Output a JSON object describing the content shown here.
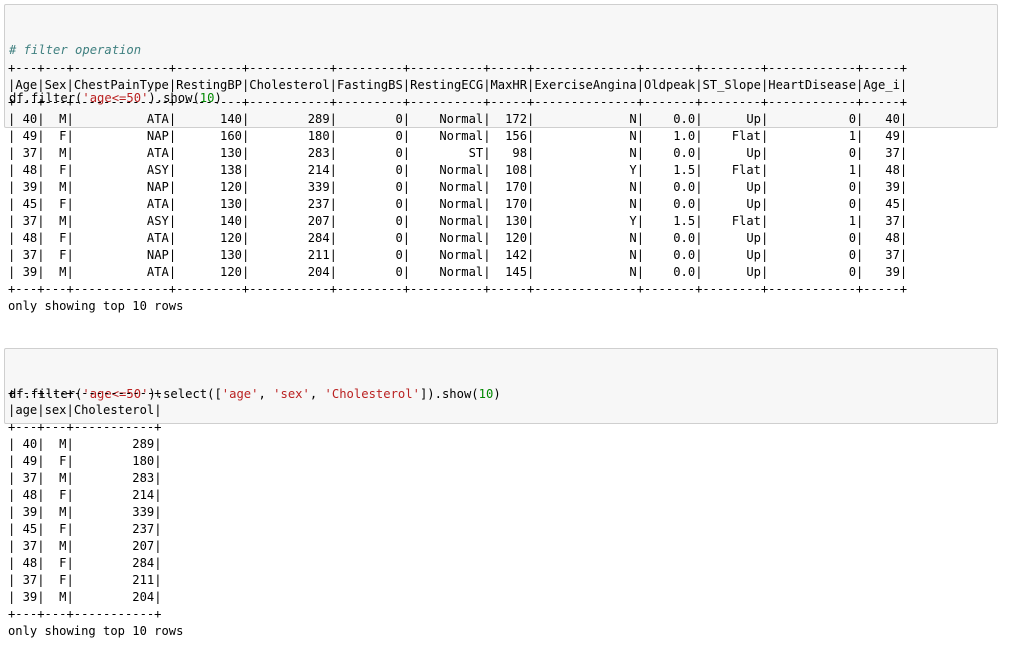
{
  "cells": [
    {
      "code_comment": "# filter operation",
      "code_line": {
        "prefix": "df.filter(",
        "arg": "'age<=50'",
        "mid": ").show(",
        "num": "10",
        "suffix": ")"
      },
      "table": {
        "columns": [
          "Age",
          "Sex",
          "ChestPainType",
          "RestingBP",
          "Cholesterol",
          "FastingBS",
          "RestingECG",
          "MaxHR",
          "ExerciseAngina",
          "Oldpeak",
          "ST_Slope",
          "HeartDisease",
          "Age_i"
        ],
        "rows": [
          [
            "40",
            "M",
            "ATA",
            "140",
            "289",
            "0",
            "Normal",
            "172",
            "N",
            "0.0",
            "Up",
            "0",
            "40"
          ],
          [
            "49",
            "F",
            "NAP",
            "160",
            "180",
            "0",
            "Normal",
            "156",
            "N",
            "1.0",
            "Flat",
            "1",
            "49"
          ],
          [
            "37",
            "M",
            "ATA",
            "130",
            "283",
            "0",
            "ST",
            "98",
            "N",
            "0.0",
            "Up",
            "0",
            "37"
          ],
          [
            "48",
            "F",
            "ASY",
            "138",
            "214",
            "0",
            "Normal",
            "108",
            "Y",
            "1.5",
            "Flat",
            "1",
            "48"
          ],
          [
            "39",
            "M",
            "NAP",
            "120",
            "339",
            "0",
            "Normal",
            "170",
            "N",
            "0.0",
            "Up",
            "0",
            "39"
          ],
          [
            "45",
            "F",
            "ATA",
            "130",
            "237",
            "0",
            "Normal",
            "170",
            "N",
            "0.0",
            "Up",
            "0",
            "45"
          ],
          [
            "37",
            "M",
            "ASY",
            "140",
            "207",
            "0",
            "Normal",
            "130",
            "Y",
            "1.5",
            "Flat",
            "1",
            "37"
          ],
          [
            "48",
            "F",
            "ATA",
            "120",
            "284",
            "0",
            "Normal",
            "120",
            "N",
            "0.0",
            "Up",
            "0",
            "48"
          ],
          [
            "37",
            "F",
            "NAP",
            "130",
            "211",
            "0",
            "Normal",
            "142",
            "N",
            "0.0",
            "Up",
            "0",
            "37"
          ],
          [
            "39",
            "M",
            "ATA",
            "120",
            "204",
            "0",
            "Normal",
            "145",
            "N",
            "0.0",
            "Up",
            "0",
            "39"
          ]
        ],
        "footer": "only showing top 10 rows"
      }
    },
    {
      "code_line": {
        "prefix": "df.filter(",
        "arg": "'age<=50'",
        "mid": ").select([",
        "list_items": [
          "'age'",
          "'sex'",
          "'Cholesterol'"
        ],
        "mid2": "]).show(",
        "num": "10",
        "suffix": ")"
      },
      "table": {
        "columns": [
          "age",
          "sex",
          "Cholesterol"
        ],
        "rows": [
          [
            "40",
            "M",
            "289"
          ],
          [
            "49",
            "F",
            "180"
          ],
          [
            "37",
            "M",
            "283"
          ],
          [
            "48",
            "F",
            "214"
          ],
          [
            "39",
            "M",
            "339"
          ],
          [
            "45",
            "F",
            "237"
          ],
          [
            "37",
            "M",
            "207"
          ],
          [
            "48",
            "F",
            "284"
          ],
          [
            "37",
            "F",
            "211"
          ],
          [
            "39",
            "M",
            "204"
          ]
        ],
        "footer": "only showing top 10 rows"
      }
    }
  ]
}
